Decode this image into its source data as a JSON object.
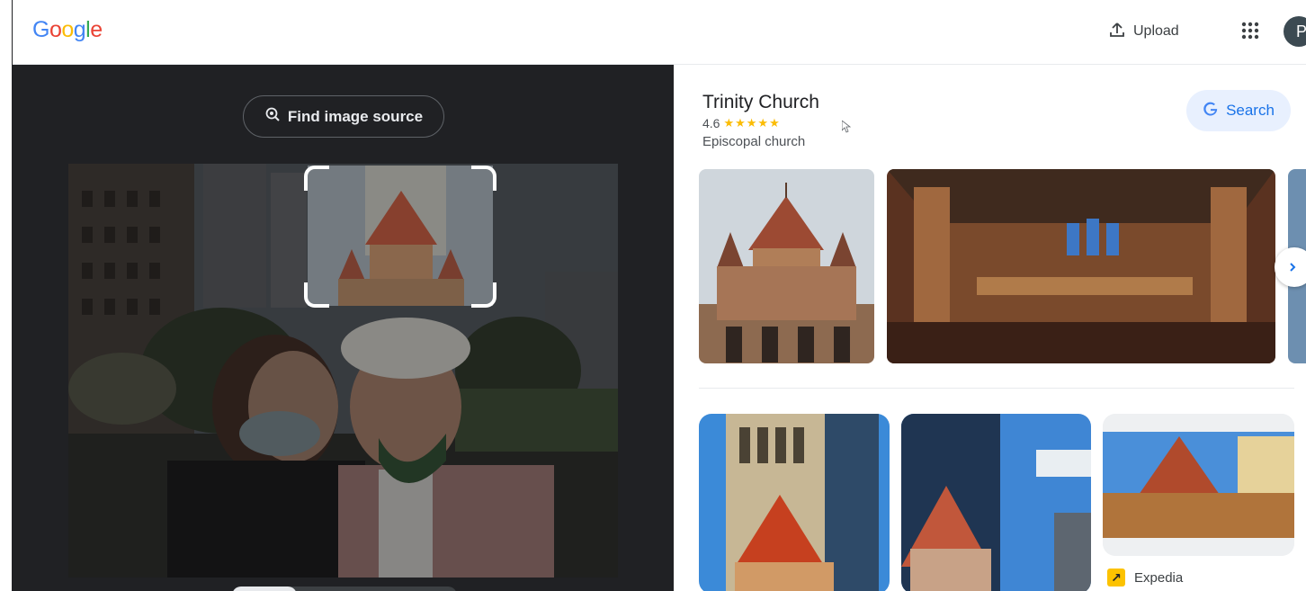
{
  "header": {
    "logo_letters": [
      "G",
      "o",
      "o",
      "g",
      "l",
      "e"
    ],
    "upload_label": "Upload",
    "avatar_initial": "P",
    "upload_icon": "upload-icon",
    "apps_icon": "apps-grid-icon"
  },
  "lens": {
    "find_source_label": "Find image source",
    "find_source_icon": "lens-search-icon"
  },
  "knowledge_panel": {
    "title": "Trinity Church",
    "rating": "4.6",
    "stars": "★★★★★",
    "rating_value": 4.6,
    "type": "Episcopal church",
    "search_label": "Search",
    "search_icon": "google-g-icon"
  },
  "results": [
    {
      "source": "Expedia",
      "source_icon": "expedia-arrow-icon"
    }
  ],
  "colors": {
    "dark_panel": "#202124",
    "accent_blue": "#1a73e8",
    "search_bg": "#e8f0fe",
    "star": "#fbbc05"
  }
}
